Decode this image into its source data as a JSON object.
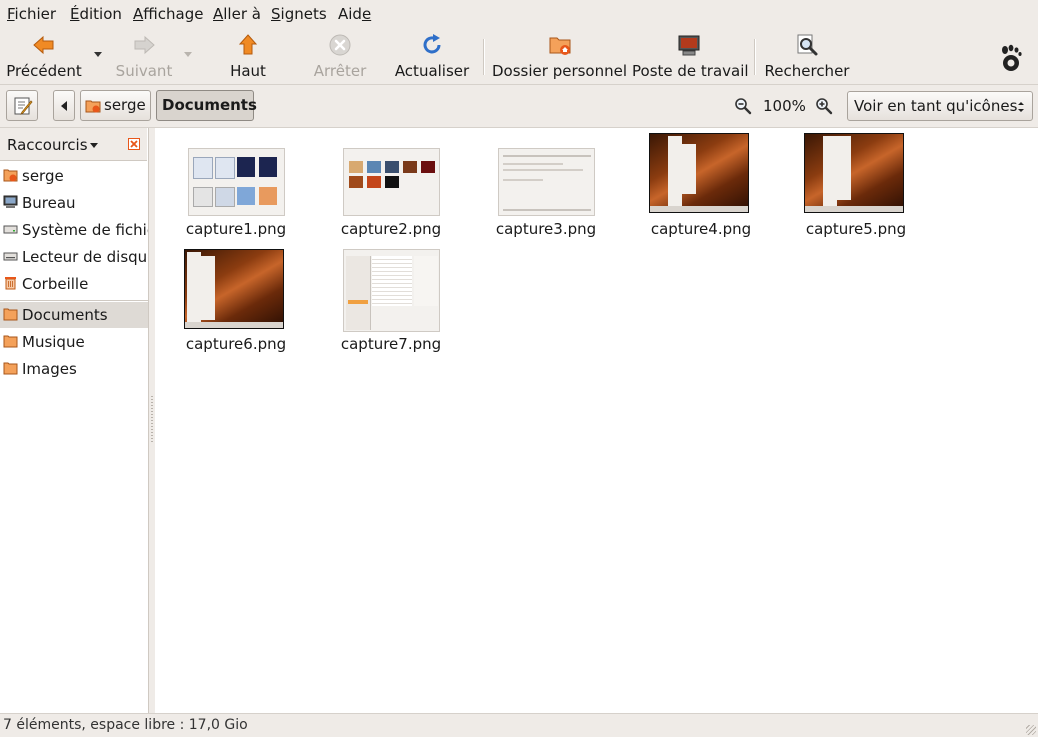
{
  "menubar": {
    "items": [
      {
        "pre": "",
        "acc": "F",
        "post": "ichier"
      },
      {
        "pre": "",
        "acc": "É",
        "post": "dition"
      },
      {
        "pre": "",
        "acc": "A",
        "post": "ffichage"
      },
      {
        "pre": "",
        "acc": "A",
        "post": "ller à"
      },
      {
        "pre": "",
        "acc": "S",
        "post": "ignets"
      },
      {
        "pre": "Aid",
        "acc": "e",
        "post": ""
      }
    ]
  },
  "toolbar": {
    "back": "Précédent",
    "forward": "Suivant",
    "up": "Haut",
    "stop": "Arrêter",
    "reload": "Actualiser",
    "home": "Dossier personnel",
    "computer": "Poste de travail",
    "search": "Rechercher"
  },
  "location": {
    "crumbs": [
      "serge",
      "Documents"
    ],
    "zoom": "100%",
    "view_mode": "Voir en tant qu'icônes"
  },
  "sidebar": {
    "title": "Raccourcis",
    "items": [
      {
        "label": "serge",
        "icon": "home-folder-icon"
      },
      {
        "label": "Bureau",
        "icon": "desktop-icon"
      },
      {
        "label": "Système de fichiers",
        "icon": "drive-icon"
      },
      {
        "label": "Lecteur de disquettes",
        "icon": "floppy-icon"
      },
      {
        "label": "Corbeille",
        "icon": "trash-icon"
      }
    ],
    "bookmarks": [
      {
        "label": "Documents",
        "icon": "folder-icon"
      },
      {
        "label": "Musique",
        "icon": "folder-icon"
      },
      {
        "label": "Images",
        "icon": "folder-icon"
      }
    ]
  },
  "files": [
    {
      "name": "capture1.png",
      "style": "light"
    },
    {
      "name": "capture2.png",
      "style": "light"
    },
    {
      "name": "capture3.png",
      "style": "light"
    },
    {
      "name": "capture4.png",
      "style": "dark"
    },
    {
      "name": "capture5.png",
      "style": "dark"
    },
    {
      "name": "capture6.png",
      "style": "dark"
    },
    {
      "name": "capture7.png",
      "style": "light"
    }
  ],
  "status": "7 éléments, espace libre : 17,0 Gio",
  "colors": {
    "accent_orange": "#f08a24",
    "reload_blue": "#2f6fc9",
    "selection_bg": "#dedad5"
  }
}
